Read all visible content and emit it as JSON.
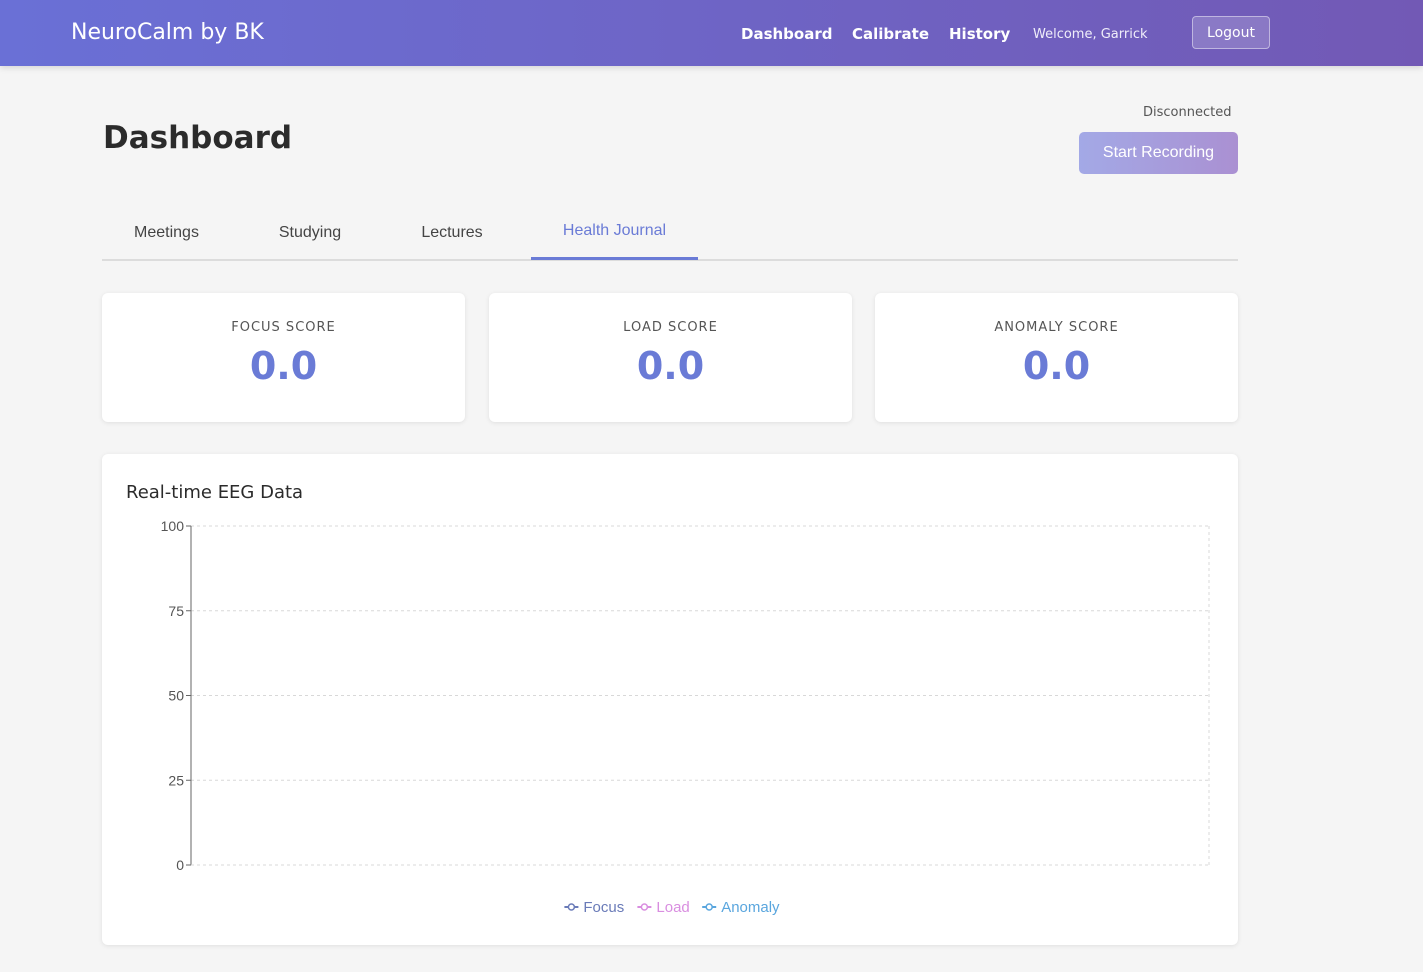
{
  "nav": {
    "brand": "NeuroCalm by BK",
    "links": [
      "Dashboard",
      "Calibrate",
      "History"
    ],
    "welcome": "Welcome, Garrick",
    "logout_label": "Logout"
  },
  "page": {
    "title": "Dashboard",
    "status": "Disconnected",
    "record_label": "Start Recording"
  },
  "tabs": [
    {
      "label": "Meetings"
    },
    {
      "label": "Studying"
    },
    {
      "label": "Lectures"
    },
    {
      "label": "Health Journal",
      "active": true
    }
  ],
  "scores": [
    {
      "label": "FOCUS SCORE",
      "value": "0.0"
    },
    {
      "label": "LOAD SCORE",
      "value": "0.0"
    },
    {
      "label": "ANOMALY SCORE",
      "value": "0.0"
    }
  ],
  "colors": {
    "accent": "#6a7bd6",
    "nav_start": "#6a70d6",
    "nav_end": "#7259b5"
  },
  "chart_data": {
    "type": "line",
    "title": "Real-time EEG Data",
    "xlabel": "",
    "ylabel": "",
    "ylim": [
      0,
      100
    ],
    "yticks": [
      0,
      25,
      50,
      75,
      100
    ],
    "grid": true,
    "legend_position": "bottom",
    "x": [],
    "series": [
      {
        "name": "Focus",
        "color": "#6a7bb8",
        "values": []
      },
      {
        "name": "Load",
        "color": "#d98ee0",
        "values": []
      },
      {
        "name": "Anomaly",
        "color": "#5aa6de",
        "values": []
      }
    ]
  }
}
